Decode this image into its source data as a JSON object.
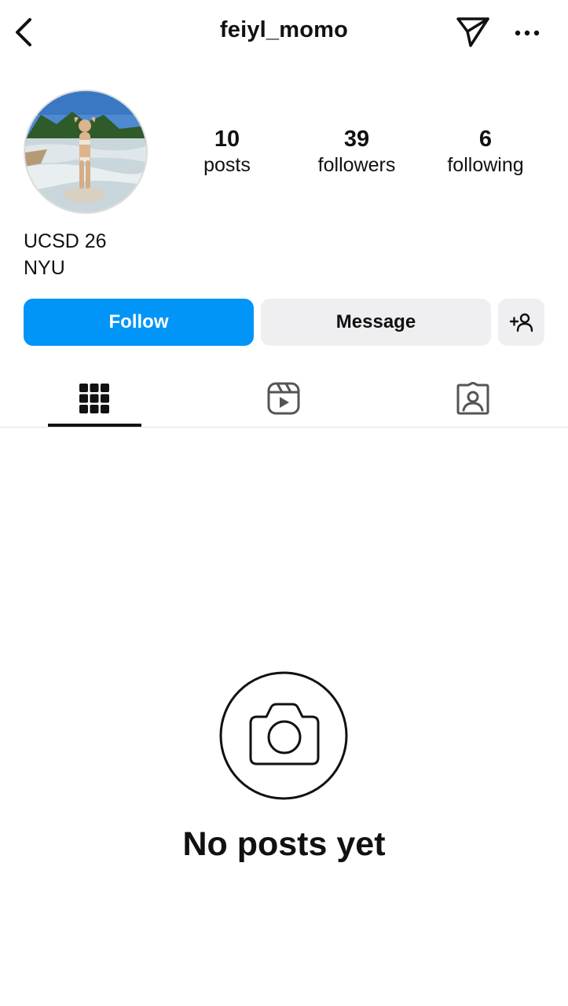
{
  "header": {
    "username": "feiyl_momo",
    "back_icon": "chevron-left-icon",
    "send_icon": "paper-plane-icon",
    "more_icon": "more-horizontal-icon"
  },
  "profile": {
    "stats": {
      "posts": {
        "value": "10",
        "label": "posts"
      },
      "followers": {
        "value": "39",
        "label": "followers"
      },
      "following": {
        "value": "6",
        "label": "following"
      }
    },
    "bio": [
      "UCSD 26",
      "NYU"
    ]
  },
  "actions": {
    "follow_label": "Follow",
    "message_label": "Message",
    "add_icon": "add-person-icon"
  },
  "tabs": [
    {
      "icon": "grid-icon",
      "active": true
    },
    {
      "icon": "reels-icon",
      "active": false
    },
    {
      "icon": "tagged-icon",
      "active": false
    }
  ],
  "empty_state": {
    "icon": "camera-icon",
    "text": "No posts yet"
  },
  "colors": {
    "follow_button": "#0095f6",
    "secondary_button": "#efeff1",
    "text": "#111111"
  }
}
